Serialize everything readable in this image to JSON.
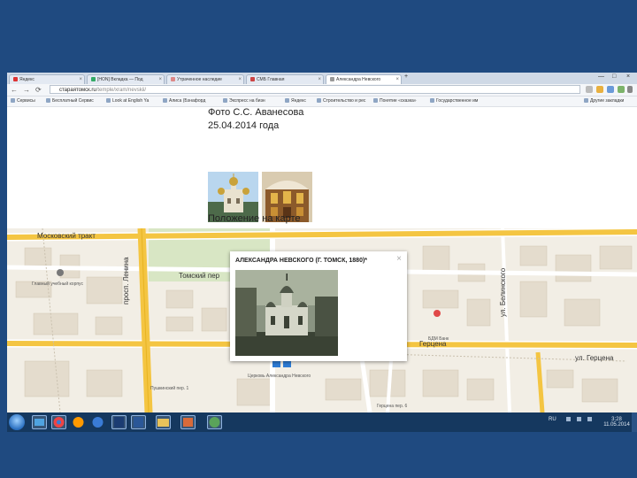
{
  "browser": {
    "tabs": [
      {
        "label": "Яндекс",
        "favicon_color": "#d33"
      },
      {
        "label": "[HON] Вкладка — Под",
        "favicon_color": "#3a6"
      },
      {
        "label": "Утраченное наследие",
        "favicon_color": "#d88"
      },
      {
        "label": "СМБ Главная",
        "favicon_color": "#c44"
      },
      {
        "label": "Александра Невского",
        "favicon_color": "#999",
        "active": true
      }
    ],
    "tab_close": "×",
    "new_tab": "+",
    "window_controls": {
      "minimize": "—",
      "maximize": "□",
      "close": "×"
    },
    "nav": {
      "back": "←",
      "forward": "→",
      "reload": "⟳"
    },
    "address": {
      "host": "стараятомск.ru",
      "path": "/temple/xram/nevskii/"
    },
    "bookmarks": [
      "Сервисы",
      "Бесплатный Сервис",
      "Look at English Ya",
      "Алиса (Бэнафорд",
      "Экспресс на бизн",
      "Яндекс",
      "Строительство и рес",
      "Понятие «сказка»",
      "Государственное им",
      "Другие закладки"
    ]
  },
  "page": {
    "photo_caption": "Фото С.С. Аванесова",
    "photo_date": "25.04.2014 года",
    "map_heading": "Положение на карте"
  },
  "map": {
    "streets": {
      "moskovsky": "Московский тракт",
      "tomsky": "Томский пер",
      "lenina": "просп. Ленина",
      "belinskogo": "ул. Белинского",
      "gertsena": "ул. Герцена",
      "gertsena_short": "Герцена"
    },
    "labels": {
      "corpus": "Главный учебный корпус",
      "stop1": "Пушкинский пер. 1",
      "bank": "БДМ Банк",
      "church": "Церковь Александра Невского",
      "stop2": "Герцена пер. 6"
    },
    "popup": {
      "title": "АЛЕКСАНДРА НЕВСКОГО (Г. ТОМСК, 1880)*",
      "close": "×"
    }
  },
  "taskbar": {
    "apps": [
      {
        "name": "explorer-folder",
        "color": "#4fa3e0"
      },
      {
        "name": "chrome",
        "color": "#e44"
      },
      {
        "name": "media-player",
        "color": "#f90"
      },
      {
        "name": "firefox",
        "color": "#3a7bd5"
      },
      {
        "name": "photoshop",
        "color": "#1b3c72"
      },
      {
        "name": "word",
        "color": "#2b5797"
      },
      {
        "name": "file-manager",
        "color": "#e8c25a"
      },
      {
        "name": "paint",
        "color": "#d86a3a"
      },
      {
        "name": "antivirus",
        "color": "#5aa35a"
      }
    ],
    "lang": "RU",
    "time": "3:28",
    "date": "11.05.2014"
  }
}
